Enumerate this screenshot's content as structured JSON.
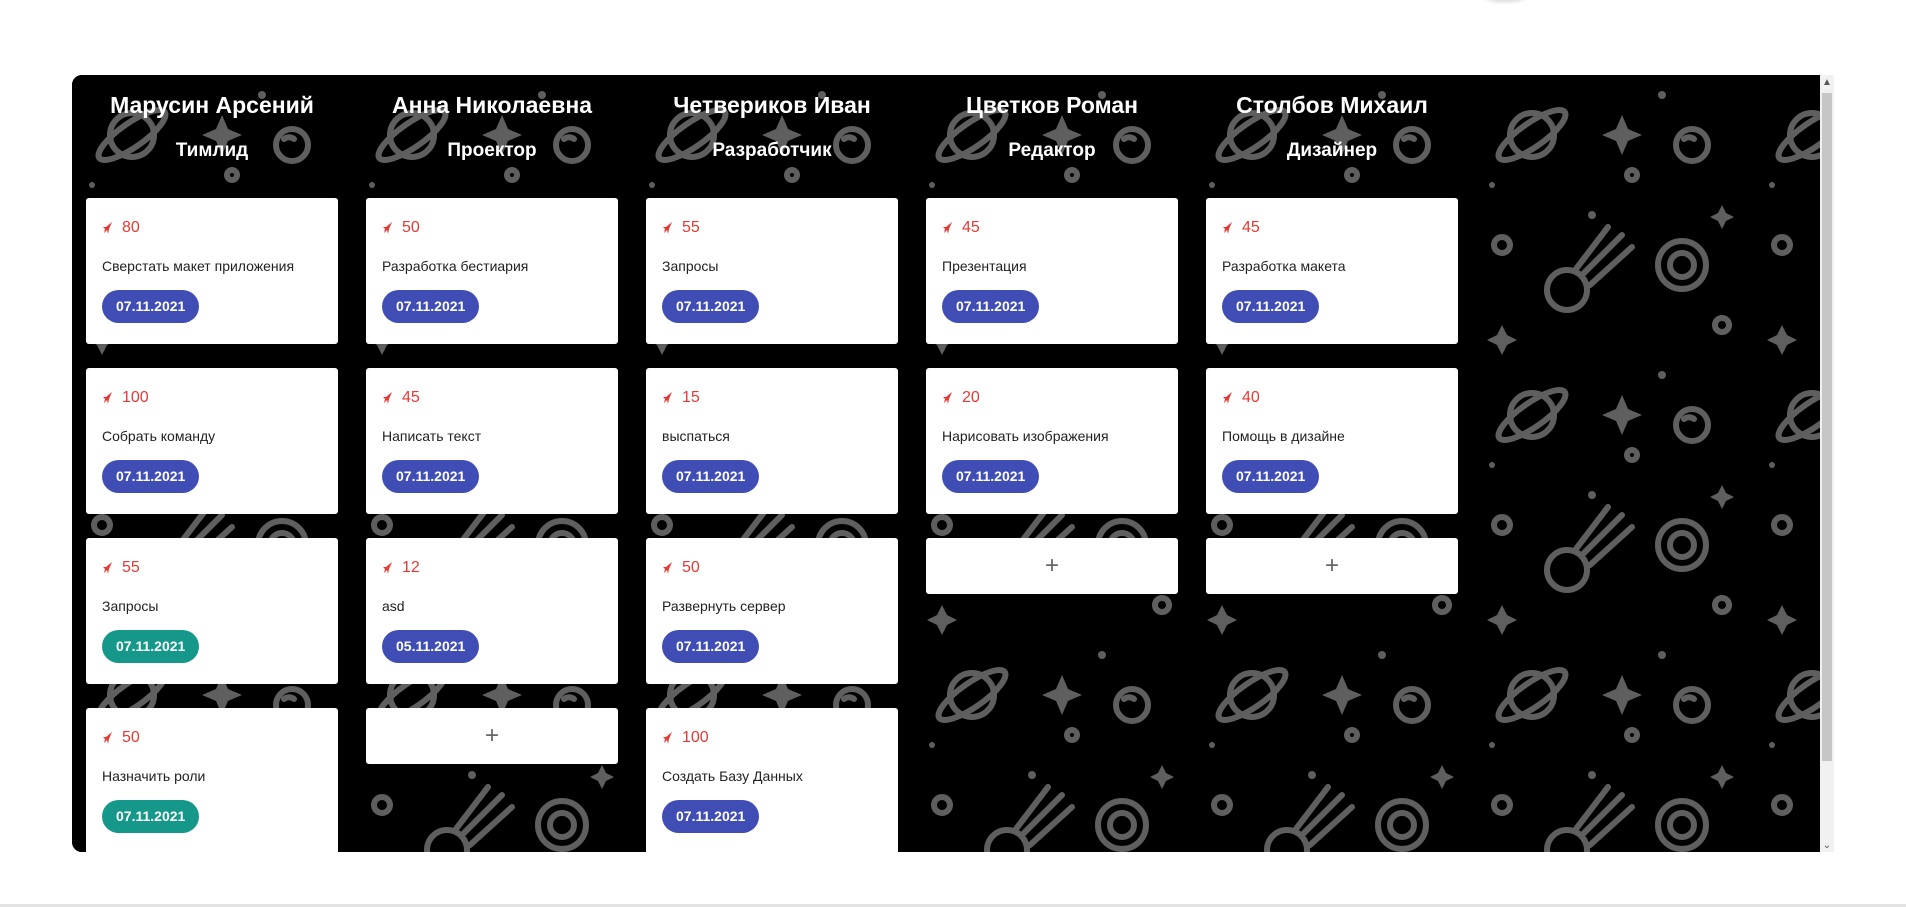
{
  "colors": {
    "board_bg": "#000000",
    "pattern": "#5f5f5f",
    "score": "#e53935",
    "date_default": "#3f4db4",
    "date_green": "#15978a",
    "card_bg": "#ffffff"
  },
  "icons": {
    "score": "rocket-icon",
    "add": "plus-icon",
    "scroll_up": "chevron-up-icon",
    "scroll_down": "chevron-down-icon"
  },
  "add_label": "+",
  "columns": [
    {
      "name": "Марусин Арсений",
      "role": "Тимлид",
      "cards": [
        {
          "score": "80",
          "title": "Сверстать макет приложения",
          "date": "07.11.2021",
          "date_color": "blue"
        },
        {
          "score": "100",
          "title": "Собрать команду",
          "date": "07.11.2021",
          "date_color": "blue"
        },
        {
          "score": "55",
          "title": "Запросы",
          "date": "07.11.2021",
          "date_color": "green"
        },
        {
          "score": "50",
          "title": "Назначить роли",
          "date": "07.11.2021",
          "date_color": "green"
        }
      ],
      "show_add": false
    },
    {
      "name": "Анна Николаевна",
      "role": "Проектор",
      "cards": [
        {
          "score": "50",
          "title": "Разработка бестиария",
          "date": "07.11.2021",
          "date_color": "blue"
        },
        {
          "score": "45",
          "title": "Написать текст",
          "date": "07.11.2021",
          "date_color": "blue"
        },
        {
          "score": "12",
          "title": "asd",
          "date": "05.11.2021",
          "date_color": "blue"
        }
      ],
      "show_add": true
    },
    {
      "name": "Четвериков Иван",
      "role": "Разработчик",
      "cards": [
        {
          "score": "55",
          "title": "Запросы",
          "date": "07.11.2021",
          "date_color": "blue"
        },
        {
          "score": "15",
          "title": "выспаться",
          "date": "07.11.2021",
          "date_color": "blue"
        },
        {
          "score": "50",
          "title": "Развернуть сервер",
          "date": "07.11.2021",
          "date_color": "blue"
        },
        {
          "score": "100",
          "title": "Создать Базу Данных",
          "date": "07.11.2021",
          "date_color": "blue"
        }
      ],
      "show_add": false
    },
    {
      "name": "Цветков Роман",
      "role": "Редактор",
      "cards": [
        {
          "score": "45",
          "title": "Презентация",
          "date": "07.11.2021",
          "date_color": "blue"
        },
        {
          "score": "20",
          "title": "Нарисовать изображения",
          "date": "07.11.2021",
          "date_color": "blue"
        }
      ],
      "show_add": true
    },
    {
      "name": "Столбов Михаил",
      "role": "Дизайнер",
      "cards": [
        {
          "score": "45",
          "title": "Разработка макета",
          "date": "07.11.2021",
          "date_color": "blue"
        },
        {
          "score": "40",
          "title": "Помощь в дизайне",
          "date": "07.11.2021",
          "date_color": "blue"
        }
      ],
      "show_add": true
    }
  ]
}
